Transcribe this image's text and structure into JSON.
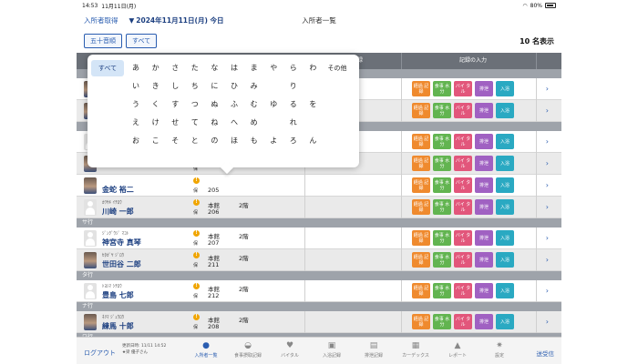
{
  "status_bar": {
    "time": "14:53",
    "date": "11月11日(月)",
    "battery": "80%",
    "wifi_icon": "wifi-icon"
  },
  "nav": {
    "back": "入所者取得",
    "date": "2024年11月11日(月) 今日",
    "title": "入所者一覧"
  },
  "filter": {
    "sort_button": "五十音順",
    "all_button": "すべて",
    "count": "10 名表示"
  },
  "table_header": {
    "col_record": "記録",
    "col_input": "記録の入力"
  },
  "groups": {
    "sa": "サ行",
    "ta": "タ行",
    "na": "ナ行",
    "wa": "ワ行"
  },
  "residents": [
    {
      "kana": "",
      "name": "",
      "building": "",
      "room": "",
      "floor": ""
    },
    {
      "kana": "",
      "name": "",
      "building": "",
      "room": "",
      "floor": ""
    },
    {
      "kana": "",
      "name": "",
      "building": "",
      "room": "",
      "floor": ""
    },
    {
      "kana": "",
      "name": "",
      "building": "",
      "room": "",
      "floor": ""
    },
    {
      "kana": "",
      "name": "金蛇 裕二",
      "building": "",
      "room": "205",
      "floor": ""
    },
    {
      "kana": "ｶﾜｻｷ ｲﾁﾛｳ",
      "name": "川崎 一郎",
      "building": "本館",
      "room": "206",
      "floor": "2階"
    },
    {
      "kana": "ｼﾞﾝｸﾞｳｼﾞ ﾏｺﾄ",
      "name": "神宮寺 真琴",
      "building": "本館",
      "room": "207",
      "floor": "2階"
    },
    {
      "kana": "ｾﾀｶﾞﾔ ｼﾞﾛｳ",
      "name": "世田谷 二郎",
      "building": "本館",
      "room": "211",
      "floor": "2階"
    },
    {
      "kana": "ﾄﾖｼﾏ ｼﾁﾛｳ",
      "name": "豊島 七郎",
      "building": "本館",
      "room": "212",
      "floor": "2階"
    },
    {
      "kana": "ﾈﾘﾏ ｼﾞｭｳﾛｳ",
      "name": "練馬 十郎",
      "building": "本館",
      "room": "208",
      "floor": "2階"
    }
  ],
  "warn_mark": "!",
  "insurance_mark": "保",
  "record_buttons": {
    "keika": "経過 記録",
    "shokuji": "食事 水分",
    "vital": "バイ タル",
    "haisetsu": "排泄",
    "nyuyoku": "入浴"
  },
  "chevron": "›",
  "kana_picker": {
    "all": "すべて",
    "other": "その他",
    "rows": [
      [
        "あ",
        "か",
        "さ",
        "た",
        "な",
        "は",
        "ま",
        "や",
        "ら",
        "わ"
      ],
      [
        "い",
        "き",
        "し",
        "ち",
        "に",
        "ひ",
        "み",
        "",
        "り",
        ""
      ],
      [
        "う",
        "く",
        "す",
        "つ",
        "ぬ",
        "ふ",
        "む",
        "ゆ",
        "る",
        "を"
      ],
      [
        "え",
        "け",
        "せ",
        "て",
        "ね",
        "へ",
        "め",
        "",
        "れ",
        ""
      ],
      [
        "お",
        "こ",
        "そ",
        "と",
        "の",
        "ほ",
        "も",
        "よ",
        "ろ",
        "ん"
      ]
    ]
  },
  "tab_bar": {
    "logout": "ログアウト",
    "updated": "更新日時: 11/11 14:52",
    "user": "★梁 優子さん",
    "tabs": [
      {
        "label": "入所者一覧",
        "icon": "residents-icon"
      },
      {
        "label": "食事摂取記録",
        "icon": "meal-icon"
      },
      {
        "label": "バイタル",
        "icon": "heart-icon"
      },
      {
        "label": "入浴記録",
        "icon": "bath-icon"
      },
      {
        "label": "排泄記録",
        "icon": "toilet-icon"
      },
      {
        "label": "カーデックス",
        "icon": "kardex-icon"
      },
      {
        "label": "レポート",
        "icon": "report-icon"
      },
      {
        "label": "設定",
        "icon": "gear-icon"
      }
    ],
    "send": "送受信"
  }
}
